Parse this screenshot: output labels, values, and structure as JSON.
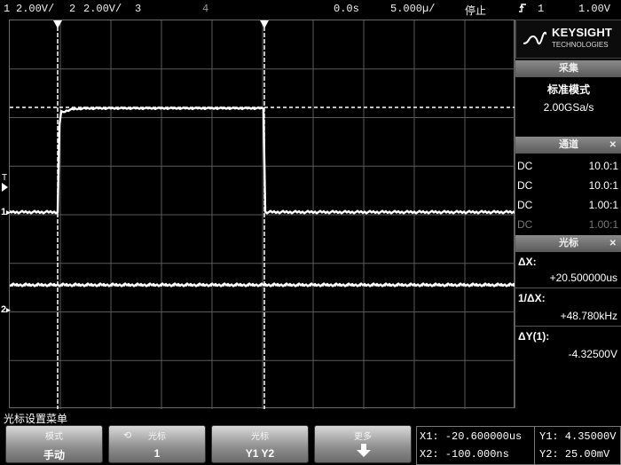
{
  "top_bar": {
    "ch1_num": "1",
    "ch1_scale": "2.00V/",
    "ch2_num": "2",
    "ch2_scale": "2.00V/",
    "ch3_num": "3",
    "ch4_num": "4",
    "time_delay": "0.0s",
    "time_base": "5.000µ/",
    "run_state": "停止",
    "trigger_icon": "trigger-edge-icon",
    "trigger_source": "1",
    "trigger_level": "1.00V"
  },
  "panel": {
    "brand": "KEYSIGHT",
    "brand_sub": "TECHNOLOGIES",
    "acq_header": "采集",
    "acq_mode": "标准模式",
    "sample_rate": "2.00GSa/s",
    "channels_header": "通道",
    "channels": [
      {
        "coupling": "DC",
        "probe": "10.0:1"
      },
      {
        "coupling": "DC",
        "probe": "10.0:1"
      },
      {
        "coupling": "DC",
        "probe": "1.00:1"
      },
      {
        "coupling": "DC",
        "probe": "1.00:1"
      }
    ],
    "cursors_header": "光标",
    "delta_x_label": "ΔX:",
    "delta_x_value": "+20.500000us",
    "inv_delta_x_label": "1/ΔX:",
    "inv_delta_x_value": "+48.780kHz",
    "delta_y_label": "ΔY(1):",
    "delta_y_value": "-4.32500V"
  },
  "markers": {
    "trigger_marker": "T",
    "ch1_marker": "1",
    "ch2_marker": "2"
  },
  "menu": {
    "title": "光标设置菜单",
    "softkeys": [
      {
        "top": "模式",
        "bottom": "手动"
      },
      {
        "top": "光标",
        "bottom": "1"
      },
      {
        "top": "光标",
        "bottom": "Y1 Y2"
      },
      {
        "top": "更多",
        "bottom": ""
      }
    ]
  },
  "readout": {
    "x1": "X1: -20.600000us",
    "x2": "X2: -100.000ns",
    "y1": "Y1: 4.35000V",
    "y2": "Y2: 25.00mV"
  },
  "colors": {
    "trace": "#ffffff",
    "grid": "#5a5a5a",
    "background": "#000000",
    "panel_header": "#7a7a7a"
  }
}
